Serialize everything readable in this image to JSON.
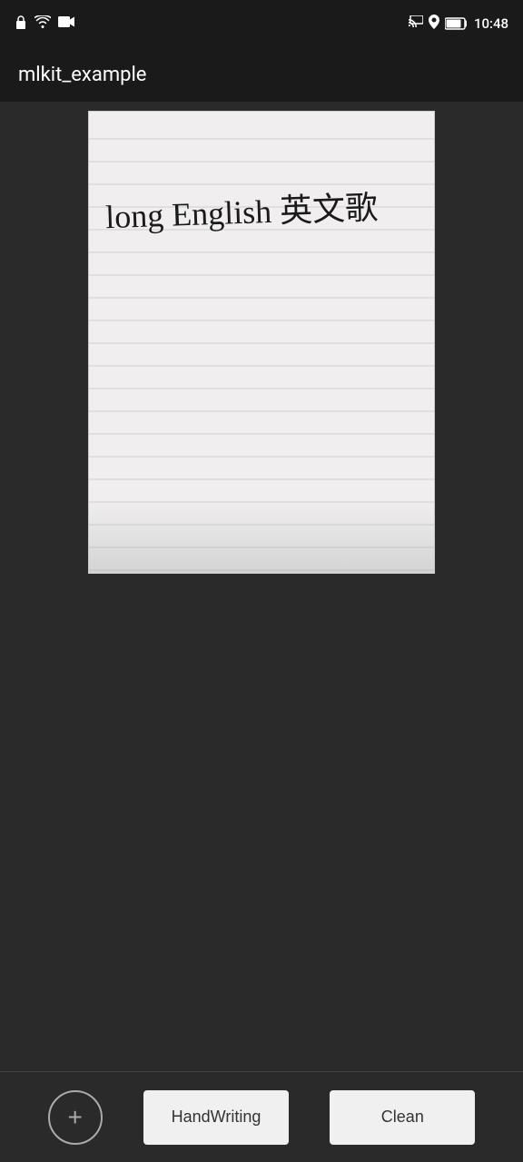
{
  "statusBar": {
    "time": "10:48",
    "icons": {
      "lock": "🔒",
      "wifi": "wifi-icon",
      "video": "video-icon",
      "cast": "cast-icon",
      "location": "location-icon",
      "battery": "battery-icon"
    }
  },
  "appBar": {
    "title": "mlkit_example"
  },
  "paper": {
    "handwritingText": "long English 英文歌",
    "lineCount": 20
  },
  "bottomBar": {
    "addButton": "+",
    "handwritingLabel": "HandWriting",
    "cleanLabel": "Clean"
  }
}
